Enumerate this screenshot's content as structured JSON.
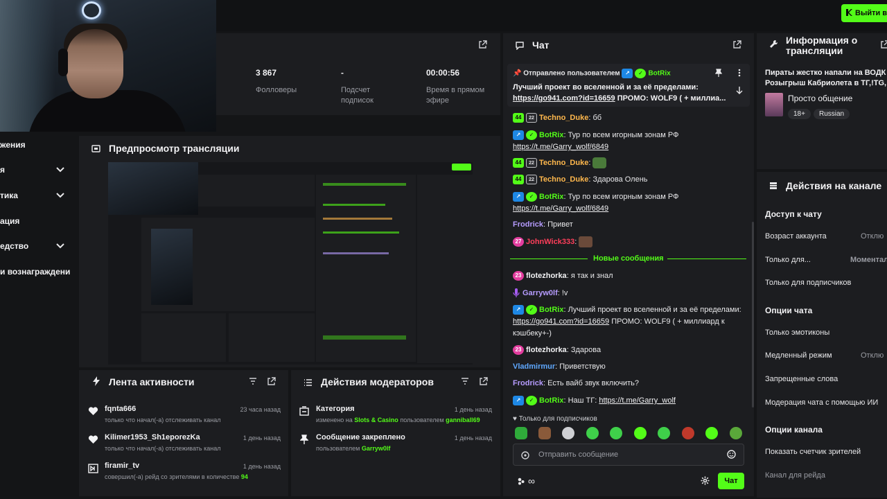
{
  "header": {
    "exit_label": "Выйти в"
  },
  "stats": [
    {
      "value": "3 867",
      "label": "Фолловеры"
    },
    {
      "value": "-",
      "label": "Подсчет подписок"
    },
    {
      "value": "00:00:56",
      "label": "Время в прямом эфире"
    }
  ],
  "sidebar": {
    "items": [
      {
        "label": "жения"
      },
      {
        "label": "я"
      },
      {
        "label": "тика"
      },
      {
        "label": "ация"
      },
      {
        "label": "едство"
      },
      {
        "label": "и вознаграждени"
      }
    ]
  },
  "preview": {
    "title": "Предпросмотр трансляции"
  },
  "activity": {
    "title": "Лента активности",
    "items": [
      {
        "user": "fqnta666",
        "desc": "только что начал(-а) отслеживать канал",
        "time": "23 часа назад",
        "icon": "heart-icon"
      },
      {
        "user": "Kilimer1953_Sh1eporezKa",
        "desc": "только что начал(-а) отслеживать канал",
        "time": "1 день назад",
        "icon": "heart-icon"
      },
      {
        "user": "firamir_tv",
        "desc": "совершил(-а) рейд со зрителями в количестве",
        "count": "94",
        "time": "1 день назад",
        "icon": "raid-icon"
      }
    ]
  },
  "moderators": {
    "title": "Действия модераторов",
    "items": [
      {
        "title": "Категория",
        "desc_prefix": "изменено на",
        "target": "Slots & Casino",
        "desc_mid": "пользователем",
        "user": "ganniball69",
        "time": "1 день назад",
        "icon": "category-icon"
      },
      {
        "title": "Сообщение закреплено",
        "desc_prefix": "пользователем",
        "user": "Garryw0lf",
        "time": "1 день назад",
        "icon": "pin-icon"
      }
    ]
  },
  "chat": {
    "title": "Чат",
    "pinned": {
      "prefix": "Отправлено пользователем",
      "user": "BotRix",
      "text": "Лучший проект во вселенной и за её пределами:",
      "link": "https://go941.com?id=16659",
      "suffix": "ПРОМО: WOLF9 ( + миллиа..."
    },
    "messages": [
      {
        "user": "Techno_Duke",
        "text": "бб"
      },
      {
        "user": "BotRix",
        "text": "Тур по всем игорным зонам РФ",
        "link": "https://t.me/Garry_wolf/6849"
      },
      {
        "user": "Techno_Duke",
        "text": ""
      },
      {
        "user": "Techno_Duke",
        "text": "Здарова Олень"
      },
      {
        "user": "BotRix",
        "text": "Тур по всем игорным зонам РФ",
        "link": "https://t.me/Garry_wolf/6849"
      },
      {
        "user": "Frodrick",
        "text": "Привет"
      },
      {
        "user": "JohnWick333",
        "text": ""
      },
      {
        "user": "flotezhorka",
        "text": "я так и знал"
      },
      {
        "user": "Garryw0lf",
        "text": "!v"
      },
      {
        "user": "BotRix",
        "text": "Лучший проект во вселенной и за её пределами:",
        "link": "https://go941.com?id=16659",
        "suffix": "ПРОМО: WOLF9 ( + миллиард к кэшбеку+-)"
      },
      {
        "user": "flotezhorka",
        "text": "Здарова"
      },
      {
        "user": "Vladmirmur",
        "text": "Приветствую"
      },
      {
        "user": "Frodrick",
        "text": "Есть вайб звук включить?"
      },
      {
        "user": "BotRix",
        "text": "Наш ТГ:",
        "link": "https://t.me/Garry_wolf"
      }
    ],
    "badges": {
      "sub": "44",
      "vip": "22",
      "sub27": "27",
      "sub23": "23"
    },
    "new_messages_label": "Новые сообщения",
    "subs_only": "Только для подписчиков",
    "input_placeholder": "Отправить сообщение",
    "send_label": "Чат"
  },
  "stream_info": {
    "title": "Информация о трансляции",
    "description": "Пираты жестко напали на ВОДК Розыгрыш Кабриолета в ТГ,!TG,",
    "category": "Просто общение",
    "tags": [
      "18+",
      "Russian"
    ]
  },
  "channel_actions": {
    "title": "Действия на канале",
    "sections": [
      {
        "heading": "Доступ к чату",
        "rows": [
          {
            "label": "Возраст аккаунта",
            "value": "Отклю"
          },
          {
            "label": "Только для...",
            "value": "Моментал"
          },
          {
            "label": "Только для подписчиков",
            "value": ""
          }
        ]
      },
      {
        "heading": "Опции чата",
        "rows": [
          {
            "label": "Только эмотиконы",
            "value": ""
          },
          {
            "label": "Медленный режим",
            "value": "Отклю"
          },
          {
            "label": "Запрещенные слова",
            "value": ""
          },
          {
            "label": "Модерация чата с помощью ИИ",
            "value": ""
          }
        ]
      },
      {
        "heading": "Опции канала",
        "rows": [
          {
            "label": "Показать счетчик зрителей",
            "value": ""
          },
          {
            "label": "Канал для рейда",
            "value": ""
          }
        ]
      }
    ]
  },
  "colors": {
    "accent": "#53fc18",
    "bg": "#141517",
    "panel": "#1c1d20"
  }
}
